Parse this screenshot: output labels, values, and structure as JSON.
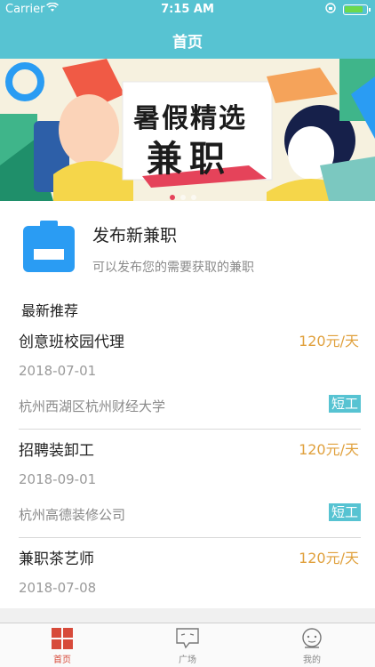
{
  "status_bar": {
    "carrier": "Carrier",
    "time": "7:15 AM"
  },
  "nav": {
    "title": "首页"
  },
  "banner": {
    "line1": "暑假精选",
    "line2": "兼职"
  },
  "publish": {
    "title": "发布新兼职",
    "subtitle": "可以发布您的需要获取的兼职"
  },
  "section": {
    "title": "最新推荐"
  },
  "jobs": [
    {
      "title": "创意班校园代理",
      "pay": "120元/天",
      "date": "2018-07-01",
      "place": "杭州西湖区杭州财经大学",
      "tag": "短工"
    },
    {
      "title": "招聘装卸工",
      "pay": "120元/天",
      "date": "2018-09-01",
      "place": "杭州高德装修公司",
      "tag": "短工"
    },
    {
      "title": "兼职茶艺师",
      "pay": "120元/天",
      "date": "2018-07-08"
    }
  ],
  "tabs": [
    {
      "label": "首页",
      "icon": "home-grid-icon"
    },
    {
      "label": "广场",
      "icon": "square-chat-icon"
    },
    {
      "label": "我的",
      "icon": "profile-face-icon"
    }
  ],
  "colors": {
    "accent": "#57c3d2",
    "pay": "#e0a03c",
    "tab_active": "#d74a3a",
    "publish_icon": "#2a9cf3"
  }
}
